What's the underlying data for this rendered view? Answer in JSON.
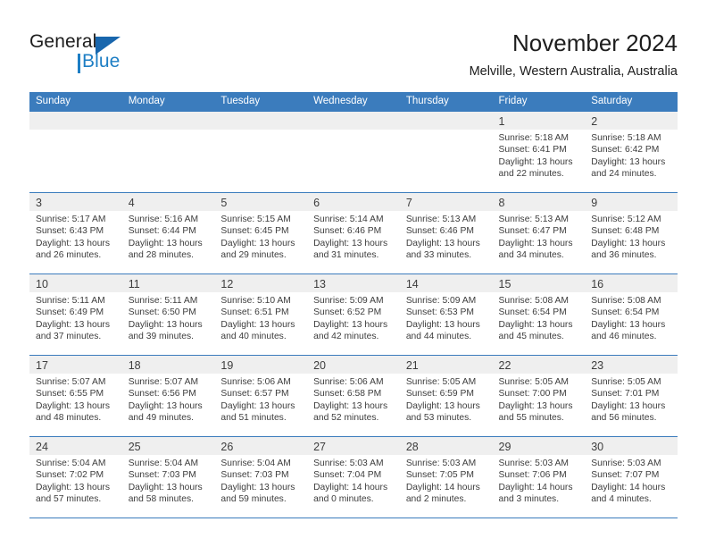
{
  "logo": {
    "word_one": "General",
    "word_two": "Blue",
    "triangle_icon": "blue-triangle-icon"
  },
  "header": {
    "title": "November 2024",
    "subtitle": "Melville, Western Australia, Australia"
  },
  "colors": {
    "header_blue": "#3b7cbd",
    "logo_blue": "#1d7ec4",
    "logo_triangle": "#1866ad",
    "daynum_band": "#efefef",
    "text": "#3d3d3d"
  },
  "calendar": {
    "weekday_headers": [
      "Sunday",
      "Monday",
      "Tuesday",
      "Wednesday",
      "Thursday",
      "Friday",
      "Saturday"
    ],
    "labels": {
      "sunrise": "Sunrise:",
      "sunset": "Sunset:",
      "daylight": "Daylight:"
    },
    "weeks": [
      [
        {
          "day": "",
          "empty": true
        },
        {
          "day": "",
          "empty": true
        },
        {
          "day": "",
          "empty": true
        },
        {
          "day": "",
          "empty": true
        },
        {
          "day": "",
          "empty": true
        },
        {
          "day": "1",
          "sunrise": "Sunrise: 5:18 AM",
          "sunset": "Sunset: 6:41 PM",
          "daylight": "Daylight: 13 hours and 22 minutes."
        },
        {
          "day": "2",
          "sunrise": "Sunrise: 5:18 AM",
          "sunset": "Sunset: 6:42 PM",
          "daylight": "Daylight: 13 hours and 24 minutes."
        }
      ],
      [
        {
          "day": "3",
          "sunrise": "Sunrise: 5:17 AM",
          "sunset": "Sunset: 6:43 PM",
          "daylight": "Daylight: 13 hours and 26 minutes."
        },
        {
          "day": "4",
          "sunrise": "Sunrise: 5:16 AM",
          "sunset": "Sunset: 6:44 PM",
          "daylight": "Daylight: 13 hours and 28 minutes."
        },
        {
          "day": "5",
          "sunrise": "Sunrise: 5:15 AM",
          "sunset": "Sunset: 6:45 PM",
          "daylight": "Daylight: 13 hours and 29 minutes."
        },
        {
          "day": "6",
          "sunrise": "Sunrise: 5:14 AM",
          "sunset": "Sunset: 6:46 PM",
          "daylight": "Daylight: 13 hours and 31 minutes."
        },
        {
          "day": "7",
          "sunrise": "Sunrise: 5:13 AM",
          "sunset": "Sunset: 6:46 PM",
          "daylight": "Daylight: 13 hours and 33 minutes."
        },
        {
          "day": "8",
          "sunrise": "Sunrise: 5:13 AM",
          "sunset": "Sunset: 6:47 PM",
          "daylight": "Daylight: 13 hours and 34 minutes."
        },
        {
          "day": "9",
          "sunrise": "Sunrise: 5:12 AM",
          "sunset": "Sunset: 6:48 PM",
          "daylight": "Daylight: 13 hours and 36 minutes."
        }
      ],
      [
        {
          "day": "10",
          "sunrise": "Sunrise: 5:11 AM",
          "sunset": "Sunset: 6:49 PM",
          "daylight": "Daylight: 13 hours and 37 minutes."
        },
        {
          "day": "11",
          "sunrise": "Sunrise: 5:11 AM",
          "sunset": "Sunset: 6:50 PM",
          "daylight": "Daylight: 13 hours and 39 minutes."
        },
        {
          "day": "12",
          "sunrise": "Sunrise: 5:10 AM",
          "sunset": "Sunset: 6:51 PM",
          "daylight": "Daylight: 13 hours and 40 minutes."
        },
        {
          "day": "13",
          "sunrise": "Sunrise: 5:09 AM",
          "sunset": "Sunset: 6:52 PM",
          "daylight": "Daylight: 13 hours and 42 minutes."
        },
        {
          "day": "14",
          "sunrise": "Sunrise: 5:09 AM",
          "sunset": "Sunset: 6:53 PM",
          "daylight": "Daylight: 13 hours and 44 minutes."
        },
        {
          "day": "15",
          "sunrise": "Sunrise: 5:08 AM",
          "sunset": "Sunset: 6:54 PM",
          "daylight": "Daylight: 13 hours and 45 minutes."
        },
        {
          "day": "16",
          "sunrise": "Sunrise: 5:08 AM",
          "sunset": "Sunset: 6:54 PM",
          "daylight": "Daylight: 13 hours and 46 minutes."
        }
      ],
      [
        {
          "day": "17",
          "sunrise": "Sunrise: 5:07 AM",
          "sunset": "Sunset: 6:55 PM",
          "daylight": "Daylight: 13 hours and 48 minutes."
        },
        {
          "day": "18",
          "sunrise": "Sunrise: 5:07 AM",
          "sunset": "Sunset: 6:56 PM",
          "daylight": "Daylight: 13 hours and 49 minutes."
        },
        {
          "day": "19",
          "sunrise": "Sunrise: 5:06 AM",
          "sunset": "Sunset: 6:57 PM",
          "daylight": "Daylight: 13 hours and 51 minutes."
        },
        {
          "day": "20",
          "sunrise": "Sunrise: 5:06 AM",
          "sunset": "Sunset: 6:58 PM",
          "daylight": "Daylight: 13 hours and 52 minutes."
        },
        {
          "day": "21",
          "sunrise": "Sunrise: 5:05 AM",
          "sunset": "Sunset: 6:59 PM",
          "daylight": "Daylight: 13 hours and 53 minutes."
        },
        {
          "day": "22",
          "sunrise": "Sunrise: 5:05 AM",
          "sunset": "Sunset: 7:00 PM",
          "daylight": "Daylight: 13 hours and 55 minutes."
        },
        {
          "day": "23",
          "sunrise": "Sunrise: 5:05 AM",
          "sunset": "Sunset: 7:01 PM",
          "daylight": "Daylight: 13 hours and 56 minutes."
        }
      ],
      [
        {
          "day": "24",
          "sunrise": "Sunrise: 5:04 AM",
          "sunset": "Sunset: 7:02 PM",
          "daylight": "Daylight: 13 hours and 57 minutes."
        },
        {
          "day": "25",
          "sunrise": "Sunrise: 5:04 AM",
          "sunset": "Sunset: 7:03 PM",
          "daylight": "Daylight: 13 hours and 58 minutes."
        },
        {
          "day": "26",
          "sunrise": "Sunrise: 5:04 AM",
          "sunset": "Sunset: 7:03 PM",
          "daylight": "Daylight: 13 hours and 59 minutes."
        },
        {
          "day": "27",
          "sunrise": "Sunrise: 5:03 AM",
          "sunset": "Sunset: 7:04 PM",
          "daylight": "Daylight: 14 hours and 0 minutes."
        },
        {
          "day": "28",
          "sunrise": "Sunrise: 5:03 AM",
          "sunset": "Sunset: 7:05 PM",
          "daylight": "Daylight: 14 hours and 2 minutes."
        },
        {
          "day": "29",
          "sunrise": "Sunrise: 5:03 AM",
          "sunset": "Sunset: 7:06 PM",
          "daylight": "Daylight: 14 hours and 3 minutes."
        },
        {
          "day": "30",
          "sunrise": "Sunrise: 5:03 AM",
          "sunset": "Sunset: 7:07 PM",
          "daylight": "Daylight: 14 hours and 4 minutes."
        }
      ]
    ]
  }
}
